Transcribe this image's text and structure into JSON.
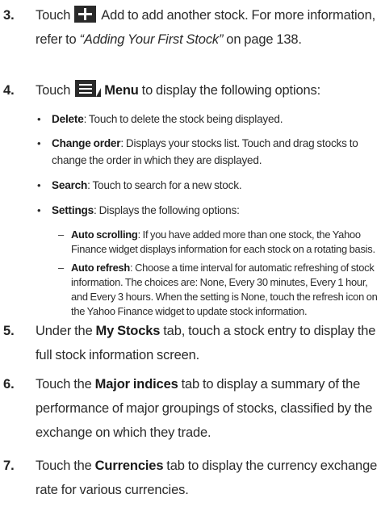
{
  "steps": [
    {
      "number": "3.",
      "before": "Touch",
      "icon": "plus-icon",
      "after": " Add to add another stock. For more information, refer to ",
      "ref": "“Adding Your First Stock”",
      "tail": " on page 138."
    },
    {
      "number": "4.",
      "before": "Touch",
      "icon": "menu-icon",
      "bold": "Menu",
      "after": " to display the following options:",
      "bullets": [
        {
          "term": "Delete",
          "text": ": Touch to delete the stock being displayed."
        },
        {
          "term": "Change order",
          "text": ": Displays your stocks list. Touch and drag stocks to change the order in which they are displayed."
        },
        {
          "term": "Search",
          "text": ": Touch to search for a new stock."
        },
        {
          "term": "Settings",
          "text": ": Displays the following options:",
          "subitems": [
            {
              "term": "Auto scrolling",
              "text": ": If you have added more than one stock, the Yahoo Finance widget displays information for each stock on a rotating basis."
            },
            {
              "term": "Auto refresh",
              "text": ": Choose a time interval for automatic refreshing of stock information. The choices are: None, Every 30 minutes, Every 1 hour, and Every 3 hours. When the setting is None, touch the refresh icon on the Yahoo Finance widget to update stock information."
            }
          ]
        }
      ]
    },
    {
      "number": "5.",
      "before": "Under the ",
      "bold": "My Stocks",
      "after": " tab, touch a stock entry to display the full stock information screen."
    },
    {
      "number": "6.",
      "before": "Touch the ",
      "bold": "Major indices",
      "after": " tab to display a summary of the performance of major groupings of stocks, classified by the exchange on which they trade."
    },
    {
      "number": "7.",
      "before": "Touch the ",
      "bold": "Currencies",
      "after": " tab to display the currency exchange rate for various currencies."
    }
  ]
}
